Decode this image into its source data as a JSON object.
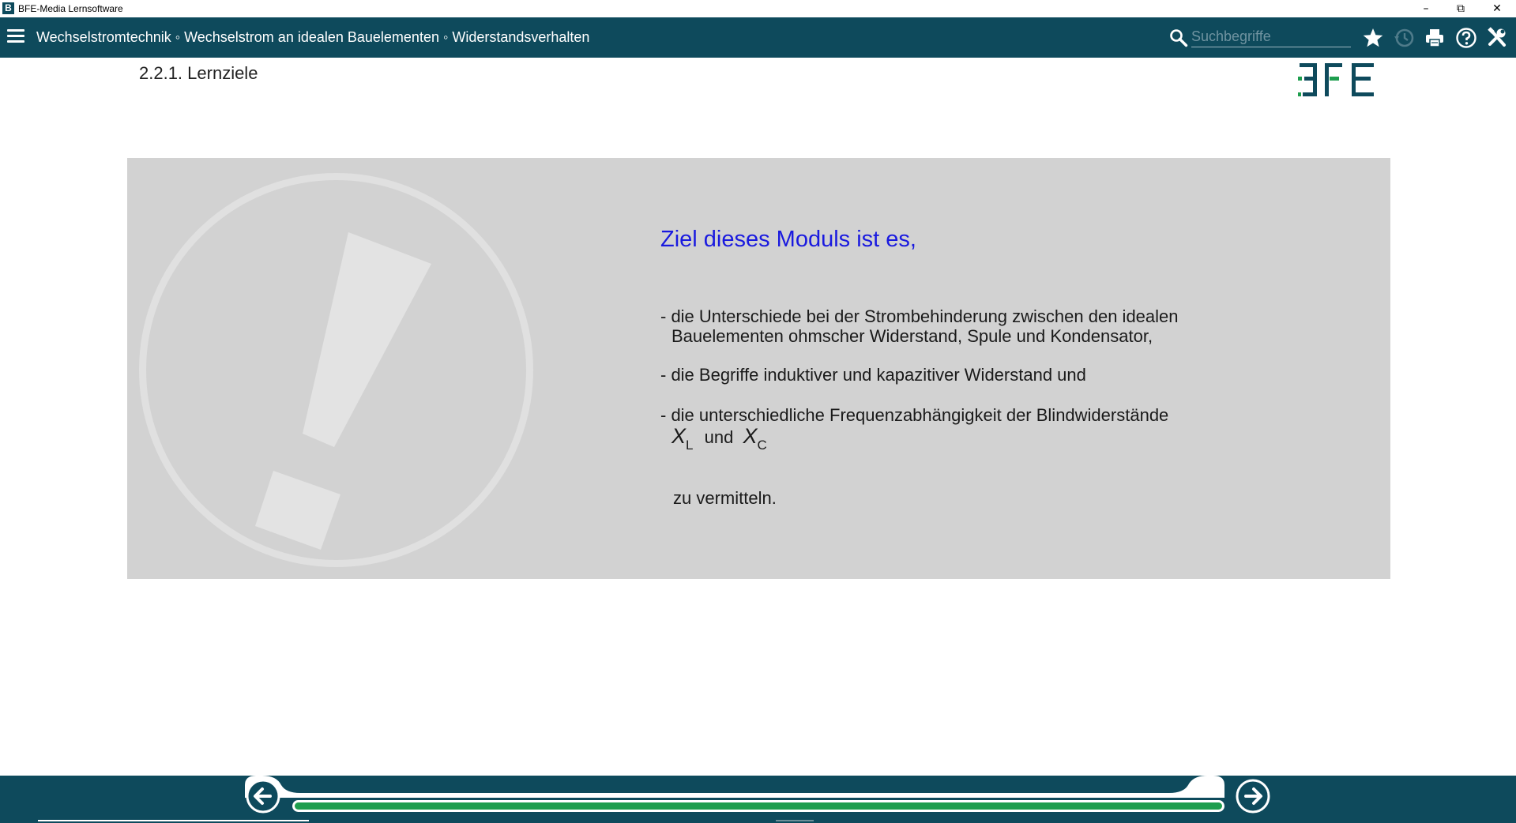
{
  "window": {
    "title": "BFE-Media Lernsoftware",
    "app_icon_letter": "B",
    "minimize": "–",
    "restore": "⧉",
    "close": "✕"
  },
  "toolbar": {
    "breadcrumb": "Wechselstromtechnik ◦ Wechselstrom an idealen Bauelementen ◦ Widerstandsverhalten",
    "search_placeholder": "Suchbegriffe",
    "icons": [
      "menu-icon",
      "search-icon",
      "star-icon",
      "history-icon",
      "print-icon",
      "help-icon",
      "tools-icon"
    ]
  },
  "page": {
    "section_title": "2.2.1. Lernziele",
    "logo_text": "BFE",
    "heading": "Ziel dieses Moduls ist es,",
    "bullet1_line1": "- die Unterschiede bei der Strombehinderung zwischen den idealen",
    "bullet1_line2": "Bauelementen ohmscher Widerstand, Spule und Kondensator,",
    "bullet2": "- die Begriffe induktiver und kapazitiver Widerstand und",
    "bullet3_line1": "- die unterschiedliche Frequenzabhängigkeit der Blindwiderstände",
    "symbol_x": "X",
    "sub_l": "L",
    "und": "und",
    "sub_c": "C",
    "closing": "zu vermitteln."
  },
  "navigation": {
    "progress": 1.0,
    "colors": {
      "bar": "#0e4a5c",
      "progress": "#1e9e4e",
      "heading": "#1a1adf",
      "panel": "#d2d2d2"
    }
  }
}
